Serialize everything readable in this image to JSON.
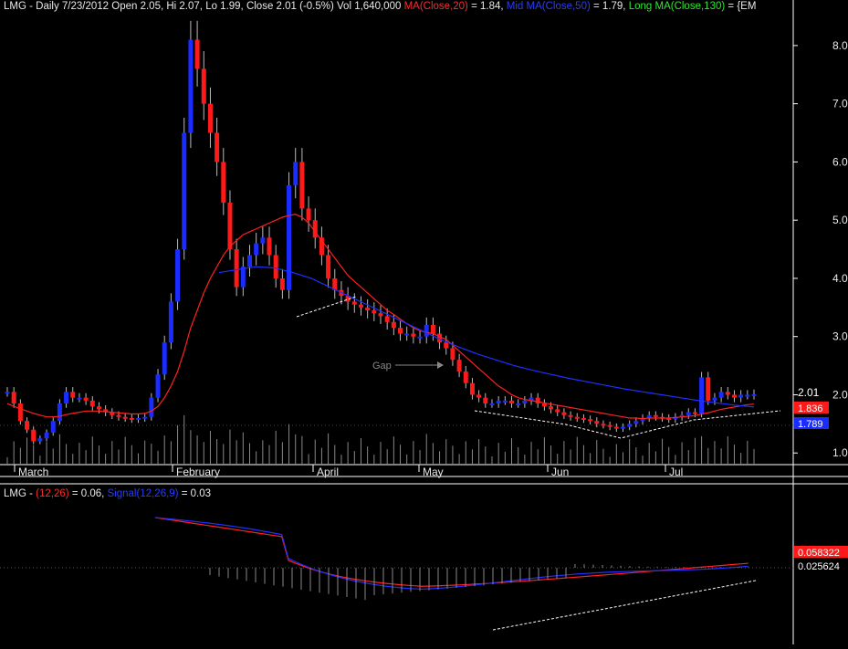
{
  "header": {
    "symbol": "LMG",
    "info": "- Daily 7/23/2012 Open 2.05, Hi 2.07, Lo 1.99, Close 2.01 (-0.5%) Vol 1,640,000",
    "ma_short": "MA(Close,20)",
    "ma_short_val": "= 1.84,",
    "ma_mid": "Mid MA(Close,50)",
    "ma_mid_val": "= 1.79,",
    "ma_long": "Long MA(Close,130)",
    "ma_long_val": "= {EM"
  },
  "macd_header": {
    "symbol": "LMG",
    "dash": "-",
    "macd": "(12,26)",
    "macd_val": "= 0.06,",
    "signal": "Signal(12,26,9)",
    "signal_val": "= 0.03"
  },
  "annotation": {
    "gap": "Gap"
  },
  "colors": {
    "background": "#000000",
    "up": "#1a2cff",
    "down": "#ff1a1a",
    "ma20": "#ff2020",
    "ma50": "#2030ff",
    "text": "#e8e8e8"
  },
  "chart_data": [
    {
      "type": "candlestick",
      "title": "LMG - Daily 7/23/2012",
      "x_tick_labels": [
        "March",
        "February",
        "April",
        "May",
        "Jun",
        "Jul"
      ],
      "y_tick_labels": [
        "1.0",
        "2.0",
        "3.0",
        "4.0",
        "5.0",
        "6.0",
        "7.0",
        "8.0"
      ],
      "ylim": [
        0.8,
        8.5
      ],
      "last_close_label": "2.01",
      "ma20_label": "1.836",
      "ma50_label": "1.789",
      "closes": [
        2.05,
        1.85,
        1.55,
        1.4,
        1.2,
        1.25,
        1.35,
        1.55,
        1.85,
        2.05,
        1.95,
        1.95,
        1.9,
        1.8,
        1.75,
        1.7,
        1.65,
        1.62,
        1.6,
        1.58,
        1.6,
        1.62,
        1.95,
        2.35,
        2.9,
        3.6,
        4.5,
        6.5,
        8.1,
        7.6,
        7.0,
        6.5,
        6.0,
        5.3,
        4.5,
        3.85,
        4.2,
        4.4,
        4.6,
        4.7,
        4.4,
        4.0,
        3.8,
        5.6,
        6.0,
        5.2,
        5.0,
        4.7,
        4.4,
        4.0,
        3.8,
        3.7,
        3.6,
        3.55,
        3.5,
        3.45,
        3.4,
        3.35,
        3.25,
        3.15,
        3.05,
        3.05,
        3.0,
        3.0,
        3.2,
        3.05,
        2.9,
        2.8,
        2.6,
        2.4,
        2.2,
        2.0,
        1.95,
        1.85,
        1.85,
        1.9,
        1.9,
        1.85,
        1.85,
        1.9,
        1.95,
        1.85,
        1.8,
        1.75,
        1.7,
        1.65,
        1.62,
        1.6,
        1.58,
        1.55,
        1.5,
        1.48,
        1.45,
        1.42,
        1.45,
        1.5,
        1.55,
        1.6,
        1.65,
        1.62,
        1.6,
        1.58,
        1.62,
        1.65,
        1.7,
        1.68,
        2.3,
        1.9,
        1.95,
        2.05,
        2.0,
        1.95,
        2.0,
        2.0,
        2.01
      ],
      "ma20": [
        1.85,
        1.8,
        1.76,
        1.72,
        1.68,
        1.65,
        1.62,
        1.62,
        1.63,
        1.66,
        1.68,
        1.7,
        1.72,
        1.72,
        1.72,
        1.71,
        1.7,
        1.69,
        1.68,
        1.67,
        1.67,
        1.68,
        1.72,
        1.8,
        1.95,
        2.15,
        2.4,
        2.75,
        3.15,
        3.45,
        3.75,
        4.0,
        4.2,
        4.4,
        4.55,
        4.65,
        4.75,
        4.8,
        4.85,
        4.9,
        4.95,
        5.0,
        5.05,
        5.08,
        5.1,
        5.05,
        4.95,
        4.8,
        4.65,
        4.5,
        4.35,
        4.2,
        4.05,
        3.95,
        3.85,
        3.75,
        3.65,
        3.55,
        3.45,
        3.38,
        3.3,
        3.22,
        3.15,
        3.1,
        3.07,
        3.05,
        3.0,
        2.95,
        2.85,
        2.75,
        2.65,
        2.55,
        2.45,
        2.35,
        2.25,
        2.15,
        2.08,
        2.0,
        1.95,
        1.92,
        1.9,
        1.88,
        1.86,
        1.84,
        1.82,
        1.8,
        1.78,
        1.76,
        1.74,
        1.72,
        1.7,
        1.68,
        1.66,
        1.64,
        1.62,
        1.6,
        1.6,
        1.59,
        1.6,
        1.6,
        1.6,
        1.6,
        1.61,
        1.62,
        1.63,
        1.64,
        1.67,
        1.69,
        1.72,
        1.75,
        1.77,
        1.79,
        1.81,
        1.83,
        1.84
      ],
      "ma50": [
        4.1,
        4.15,
        4.2,
        4.18,
        4.1,
        4.0,
        3.85,
        3.7,
        3.55,
        3.4,
        3.25,
        3.1,
        2.95,
        2.82,
        2.7,
        2.6,
        2.5,
        2.42,
        2.35,
        2.28,
        2.22,
        2.16,
        2.1,
        2.05,
        2.0,
        1.95,
        1.9,
        1.86,
        1.82,
        1.79
      ],
      "macd_ylim": [
        -0.5,
        1.4
      ]
    }
  ]
}
